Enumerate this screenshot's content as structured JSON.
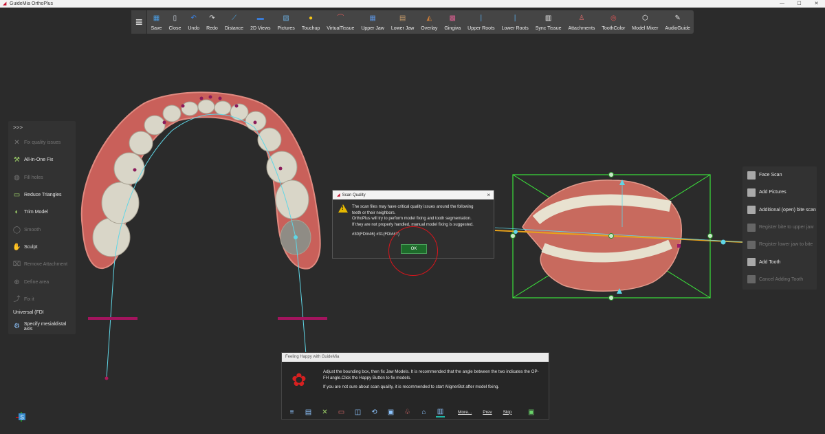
{
  "app": {
    "title": "GuideMia OrthoPlus"
  },
  "toolbar": {
    "items": [
      {
        "label": "Save",
        "icon": "save-icon",
        "color": "#4a9be0"
      },
      {
        "label": "Close",
        "icon": "close-file-icon",
        "color": "#cfd6e0"
      },
      {
        "label": "Undo",
        "icon": "undo-icon",
        "color": "#3a83e8"
      },
      {
        "label": "Redo",
        "icon": "redo-icon",
        "color": "#e0e0e0"
      },
      {
        "label": "Distance",
        "icon": "ruler-icon",
        "color": "#4aa8e8"
      },
      {
        "label": "2D Views",
        "icon": "2d-views-icon",
        "color": "#3a7bd5"
      },
      {
        "label": "Pictures",
        "icon": "pictures-icon",
        "color": "#6aa9d8"
      },
      {
        "label": "Touchup",
        "icon": "touchup-icon",
        "color": "#f5c518"
      },
      {
        "label": "VirtualTissue",
        "icon": "virtual-tissue-icon",
        "color": "#d65a5a"
      },
      {
        "label": "Upper Jaw",
        "icon": "upper-jaw-icon",
        "color": "#5b8fd6"
      },
      {
        "label": "Lower Jaw",
        "icon": "lower-jaw-icon",
        "color": "#c59a6a"
      },
      {
        "label": "Overlay",
        "icon": "overlay-icon",
        "color": "#c77b3a"
      },
      {
        "label": "Gingiva",
        "icon": "gingiva-icon",
        "color": "#d85f8f"
      },
      {
        "label": "Upper Roots",
        "icon": "upper-roots-icon",
        "color": "#5ab0f0"
      },
      {
        "label": "Lower Roots",
        "icon": "lower-roots-icon",
        "color": "#5ab0f0"
      },
      {
        "label": "Sync Tissue",
        "icon": "sync-tissue-icon",
        "color": "#f0f0f0"
      },
      {
        "label": "Attachments",
        "icon": "attachments-icon",
        "color": "#e06b6b"
      },
      {
        "label": "ToothColor",
        "icon": "tooth-color-icon",
        "color": "#e05555"
      },
      {
        "label": "Model Mixer",
        "icon": "model-mixer-icon",
        "color": "#f0f0f0"
      },
      {
        "label": "AudioGuide",
        "icon": "audio-guide-icon",
        "color": "#e0e0e0"
      }
    ]
  },
  "left_panel": {
    "header": ">>>",
    "items": [
      {
        "label": "Fix quality issues",
        "enabled": false,
        "icon": "tools-icon"
      },
      {
        "label": "All-in-One Fix",
        "enabled": true,
        "icon": "all-in-one-fix-icon"
      },
      {
        "label": "Fill holes",
        "enabled": false,
        "icon": "fill-holes-icon"
      },
      {
        "label": "Reduce Triangles",
        "enabled": true,
        "icon": "reduce-triangles-icon"
      },
      {
        "label": "Trim Model",
        "enabled": true,
        "icon": "trim-model-icon"
      },
      {
        "label": "Smooth",
        "enabled": false,
        "icon": "smooth-icon"
      },
      {
        "label": "Sculpt",
        "enabled": true,
        "icon": "sculpt-icon"
      },
      {
        "label": "Remove Attachment",
        "enabled": false,
        "icon": "remove-attachment-icon"
      },
      {
        "label": "Define area",
        "enabled": false,
        "icon": "define-area-icon"
      },
      {
        "label": "Fix it",
        "enabled": false,
        "icon": "fix-it-icon"
      }
    ],
    "numbering_select": "Universal (FDI",
    "bottom_item": {
      "label": "Specify mesialdistal axis",
      "icon": "axis-icon"
    }
  },
  "right_panel": {
    "items": [
      {
        "label": "Face Scan",
        "enabled": true
      },
      {
        "label": "Add Pictures",
        "enabled": true
      },
      {
        "label": "Additional (open) bite scan",
        "enabled": true
      },
      {
        "label": "Register bite to upper jaw",
        "enabled": false
      },
      {
        "label": "Register lower jaw to bite",
        "enabled": false
      },
      {
        "label": "Add Tooth",
        "enabled": true
      },
      {
        "label": "Cancel Adding Tooth",
        "enabled": false
      }
    ]
  },
  "scan_dialog": {
    "title": "Scan Quality",
    "message_lines": [
      "The scan files may have critical quality issues around the following",
      "teeth or their neighbors.",
      "OrthoPlus will try to perform model fixing and tooth segmentation.",
      "If they are not properly handled, manual model fixing is suggested."
    ],
    "teeth": "#30(FDI#46) #31(FDI#47)",
    "ok_label": "OK",
    "close_glyph": "×"
  },
  "happy_dialog": {
    "title": "Feeling Happy with GuideMia",
    "line1": "Adjust the bounding box, then fix Jaw Models. It is recommended that the angle between the two indicates the OP-FH angle.Click the Happy Button to fix models.",
    "line2": "If you are not sure about scan quality, it is recommended to start AlignerBot after model fixing.",
    "links": [
      "More...",
      "Prev",
      "Skip"
    ]
  },
  "gizmo_label": "S"
}
